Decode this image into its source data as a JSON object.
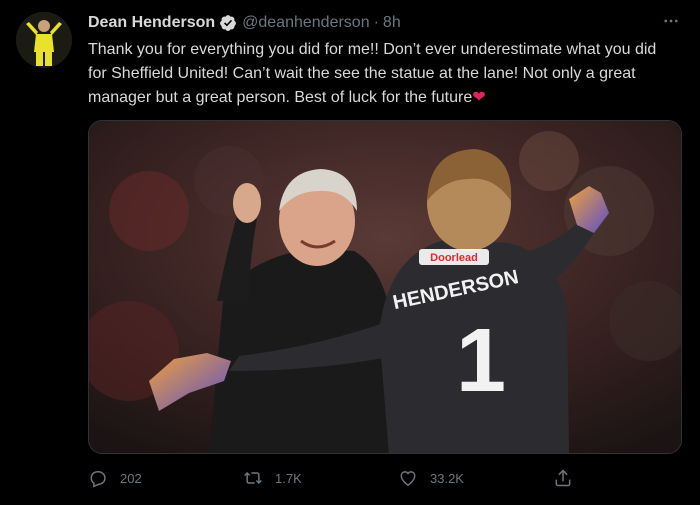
{
  "author": {
    "display_name": "Dean Henderson",
    "handle": "@deanhenderson",
    "separator": "·",
    "time": "8h"
  },
  "tweet": {
    "text": "Thank you for everything you did for me!! Don’t ever underestimate what you did for Sheffield United! Can’t wait the see the statue at the lane! Not only a great manager but a great person. Best of luck for the future",
    "emoji": "❤"
  },
  "media": {
    "jersey_name": "HENDERSON",
    "jersey_number": "1",
    "sponsor": "Doorlead"
  },
  "actions": {
    "replies": "202",
    "retweets": "1.7K",
    "likes": "33.2K"
  },
  "icons": {
    "reply": "reply-icon",
    "retweet": "retweet-icon",
    "like": "heart-icon",
    "share": "share-icon",
    "more": "more-icon",
    "verified": "verified-badge-icon"
  },
  "colors": {
    "background": "#000000",
    "text": "#d9d9d9",
    "muted": "#6e767d",
    "heart": "#e0245e"
  }
}
